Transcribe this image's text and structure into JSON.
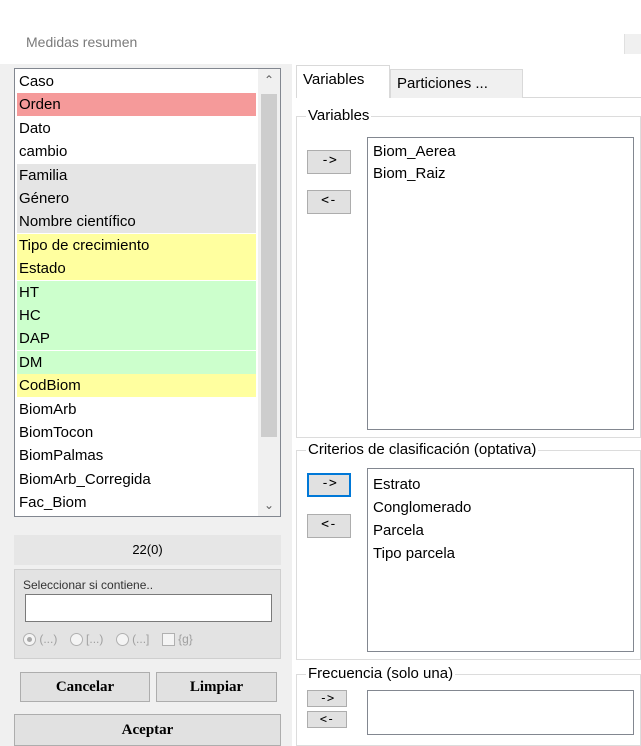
{
  "window": {
    "title": "Medidas resumen"
  },
  "variable_list": {
    "items": [
      {
        "label": "Caso",
        "color": "#ffffff"
      },
      {
        "label": "Orden",
        "color": "#f59a9a"
      },
      {
        "label": "Dato",
        "color": "#ffffff"
      },
      {
        "label": "cambio",
        "color": "#ffffff"
      },
      {
        "label": "Familia",
        "color": "#e5e5e5"
      },
      {
        "label": "Género",
        "color": "#e5e5e5"
      },
      {
        "label": "Nombre científico",
        "color": "#e5e5e5"
      },
      {
        "label": "Tipo de crecimiento",
        "color": "#ffff9f"
      },
      {
        "label": "Estado",
        "color": "#ffff9f"
      },
      {
        "label": "HT",
        "color": "#ccffcc"
      },
      {
        "label": "HC",
        "color": "#ccffcc"
      },
      {
        "label": "DAP",
        "color": "#ccffcc"
      },
      {
        "label": "DM",
        "color": "#ccffcc"
      },
      {
        "label": "CodBiom",
        "color": "#ffff9f"
      },
      {
        "label": "BiomArb",
        "color": "#ffffff"
      },
      {
        "label": "BiomTocon",
        "color": "#ffffff"
      },
      {
        "label": "BiomPalmas",
        "color": "#ffffff"
      },
      {
        "label": "BiomArb_Corregida",
        "color": "#ffffff"
      },
      {
        "label": "Fac_Biom",
        "color": "#ffffff"
      }
    ],
    "count": "22(0)"
  },
  "filter": {
    "label": "Seleccionar si contiene..",
    "value": "",
    "options": [
      "(...)",
      "[...)",
      "(...]",
      "{g}"
    ]
  },
  "buttons": {
    "cancel": "Cancelar",
    "clear": "Limpiar",
    "accept": "Aceptar"
  },
  "tabs": [
    {
      "label": "Variables",
      "active": true
    },
    {
      "label": "Particiones ...",
      "active": false
    }
  ],
  "variables_section": {
    "legend": "Variables",
    "add": "->",
    "remove": "<-",
    "items": [
      "Biom_Aerea",
      "Biom_Raiz"
    ]
  },
  "criteria_section": {
    "legend": "Criterios de clasificación (optativa)",
    "add": "->",
    "remove": "<-",
    "items": [
      "Estrato",
      "Conglomerado",
      "Parcela",
      "Tipo parcela"
    ]
  },
  "frequency_section": {
    "legend": "Frecuencia (solo una)",
    "add": "->",
    "remove": "<-"
  }
}
